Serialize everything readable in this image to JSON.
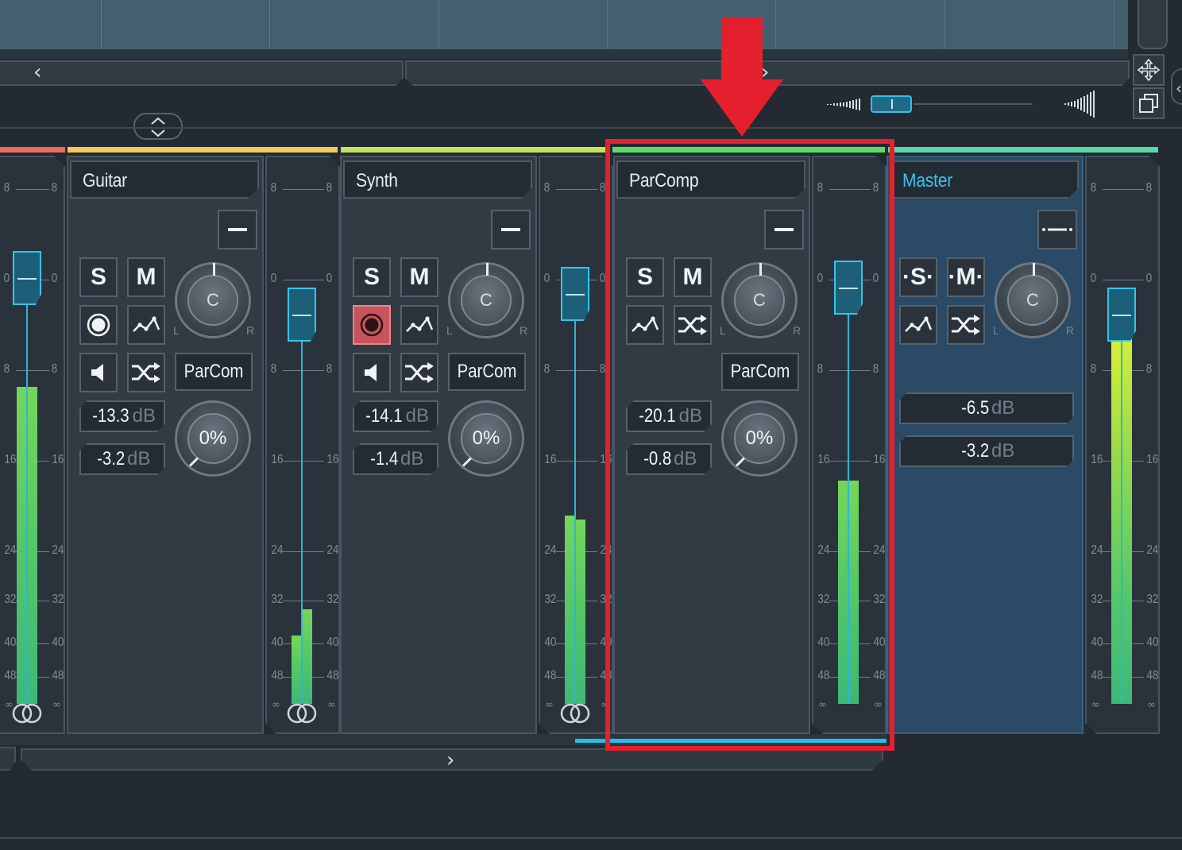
{
  "navigation": {
    "left_arrow": "‹",
    "right_arrow": "›",
    "bottom_arrow": "›"
  },
  "toolbar": {
    "move_icon": "move-icon",
    "window_icon": "window-icon",
    "expand_icon": "expand-collapse-icon",
    "collapse_arrow": "‹"
  },
  "channels": [
    {
      "name": "Guitar",
      "strip_color": "#f2c95a",
      "solo": "S",
      "mute": "M",
      "insert": "ParCom",
      "volume": "-13.3",
      "send": "-3.2",
      "unit": "dB",
      "pan": "C",
      "width": "0%",
      "pan_l": "L",
      "pan_r": "R",
      "record_armed": false
    },
    {
      "name": "Synth",
      "strip_color": "#c4e45a",
      "solo": "S",
      "mute": "M",
      "insert": "ParCom",
      "volume": "-14.1",
      "send": "-1.4",
      "unit": "dB",
      "pan": "C",
      "width": "0%",
      "pan_l": "L",
      "pan_r": "R",
      "record_armed": true
    },
    {
      "name": "ParComp",
      "strip_color": "#5ddc66",
      "solo": "S",
      "mute": "M",
      "insert": "ParCom",
      "volume": "-20.1",
      "send": "-0.8",
      "unit": "dB",
      "pan": "C",
      "width": "0%",
      "pan_l": "L",
      "pan_r": "R",
      "selected": true
    },
    {
      "name": "Master",
      "strip_color": "#5ad8a8",
      "solo": "·S·",
      "mute": "·M·",
      "volume": "-6.5",
      "send": "-3.2",
      "unit": "dB",
      "pan": "C",
      "pan_l": "L",
      "pan_r": "R",
      "name_color": "#39c3ee"
    }
  ],
  "meter_scale": {
    "top": [
      "8",
      "0",
      "8",
      "16",
      "24",
      "32",
      "40",
      "48"
    ],
    "inf": "∞"
  },
  "meters": [
    {
      "channel": "left-partial",
      "levels": [
        0.74,
        0.74
      ]
    },
    {
      "channel": "Guitar",
      "levels": [
        0.16,
        0.22
      ]
    },
    {
      "channel": "Synth",
      "levels": [
        0.44,
        0.43
      ]
    },
    {
      "channel": "ParComp",
      "levels": [
        0.52,
        0.52
      ]
    },
    {
      "channel": "Master",
      "levels": [
        0.85,
        0.87
      ]
    }
  ],
  "accent": {
    "highlight": "#e5202e",
    "selection": "#1fc0ec",
    "fader": "#34c5e8"
  }
}
